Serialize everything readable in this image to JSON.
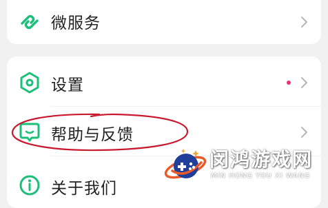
{
  "menu": {
    "top_item": {
      "label": "微服务",
      "icon": "link-icon"
    },
    "items": [
      {
        "label": "设置",
        "icon": "settings-hexagon-icon",
        "has_badge_dot": true
      },
      {
        "label": "帮助与反馈",
        "icon": "feedback-chat-icon",
        "has_badge_dot": false
      },
      {
        "label": "关于我们",
        "icon": "info-icon",
        "has_badge_dot": false
      }
    ]
  },
  "watermark": {
    "title": "闵鸿游戏网",
    "subtitle": "MIN HONG YOU XI WANG"
  },
  "colors": {
    "accent_green": "#1bbf7a",
    "badge_dot": "#e8336d",
    "highlight_oval": "#c8192f",
    "chevron": "#b5b5b5",
    "background": "#f1f1f1"
  }
}
